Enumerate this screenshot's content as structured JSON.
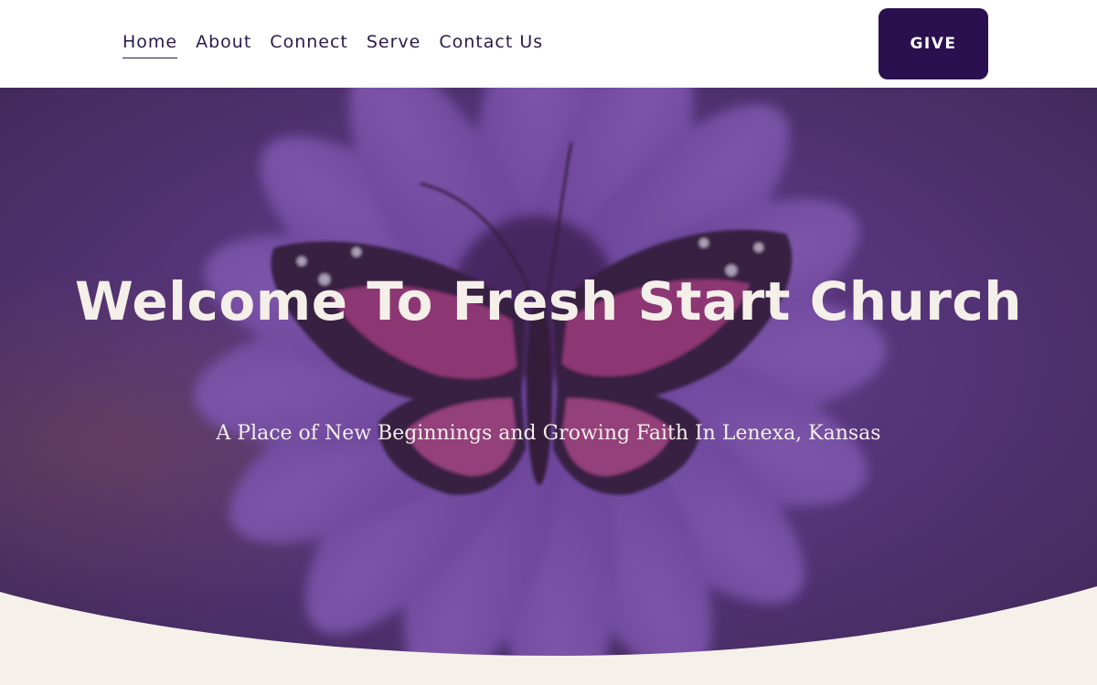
{
  "nav": {
    "items": [
      {
        "label": "Home",
        "active": true
      },
      {
        "label": "About",
        "active": false
      },
      {
        "label": "Connect",
        "active": false
      },
      {
        "label": "Serve",
        "active": false
      },
      {
        "label": "Contact Us",
        "active": false
      }
    ],
    "give_label": "GIVE"
  },
  "hero": {
    "title": "Welcome To Fresh Start Church",
    "subtitle": "A Place of New Beginnings and Growing Faith In Lenexa, Kansas",
    "background_image": "purple-flower-with-butterfly"
  },
  "colors": {
    "header_bg": "#ffffff",
    "nav_text": "#2a1a4a",
    "give_button": "#2b1050",
    "hero_overlay": "#5a3e78",
    "hero_text": "#f4efe8",
    "page_bg": "#f5f1ea"
  }
}
